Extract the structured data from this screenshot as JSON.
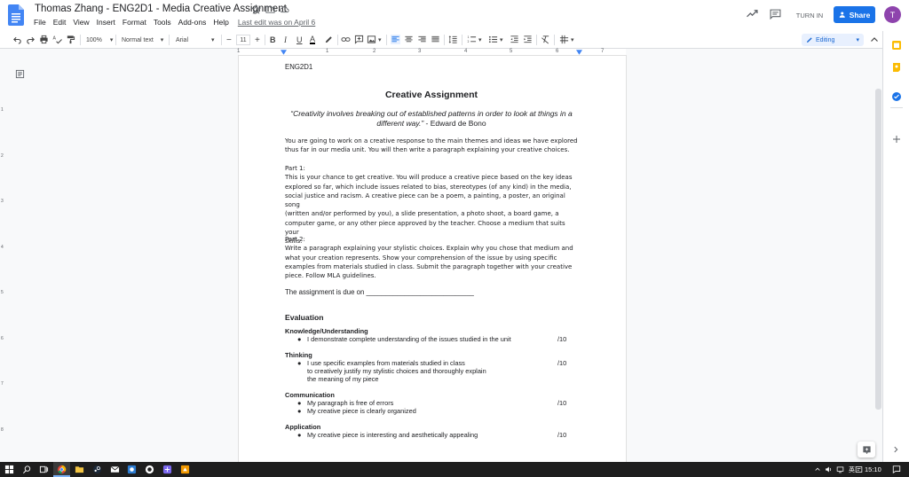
{
  "window": {
    "doc_title": "Thomas Zhang - ENG2D1 - Media Creative Assignment",
    "menu": [
      "File",
      "Edit",
      "View",
      "Insert",
      "Format",
      "Tools",
      "Add-ons",
      "Help"
    ],
    "last_edit": "Last edit was on April 6",
    "turn_in_label": "TURN IN",
    "share_label": "Share",
    "avatar_letter": "T"
  },
  "toolbar": {
    "zoom": "100%",
    "style": "Normal text",
    "font": "Arial",
    "font_size": "11",
    "mode": "Editing"
  },
  "ruler": {
    "numbers": [
      "1",
      "1",
      "2",
      "3",
      "4",
      "5",
      "6",
      "7"
    ],
    "vnumbers": [
      "1",
      "2",
      "3",
      "4",
      "5",
      "6",
      "7",
      "8"
    ]
  },
  "document": {
    "course": "ENG2D1",
    "title": "Creative Assignment",
    "quote_line1": "“Creativity involves breaking out of established patterns in order to look at things in a",
    "quote_line2": "different way.”",
    "quote_author": " - Edward de Bono",
    "intro": [
      "You are going to work on a creative response to the main themes and ideas we have explored",
      "thus far in our media unit. You will then write a paragraph explaining your creative choices."
    ],
    "part1_heading": "Part 1:",
    "part1": [
      "This is your chance to get creative. You will produce a creative piece based on the key ideas",
      "explored so far, which include issues related to bias, stereotypes (of any kind) in the media,",
      "social justice and racism. A creative piece can be a poem, a painting, a poster, an original song",
      "(written and/or performed by you), a slide presentation, a photo shoot, a board game, a",
      "computer game, or any other piece approved by the teacher. Choose a medium that suits your",
      "skills."
    ],
    "part2_heading": "Part 2:",
    "part2": [
      "Write a paragraph explaining your stylistic choices. Explain why you chose that medium and",
      "what your creation represents.  Show your comprehension of the issue by using specific",
      "examples from materials studied in class. Submit the paragraph together with your creative",
      "piece. Follow MLA guidelines."
    ],
    "due": "The assignment is due on ____________________________",
    "evaluation_heading": "Evaluation",
    "criteria": [
      {
        "name": "Knowledge/Understanding",
        "items": [
          {
            "text": "I demonstrate complete understanding of the issues studied in the unit",
            "score": "/10",
            "cont": []
          }
        ]
      },
      {
        "name": "Thinking",
        "items": [
          {
            "text": "I use specific examples from materials studied in class",
            "score": "/10",
            "cont": [
              "to creatively justify my stylistic choices and thoroughly explain",
              "the meaning of my piece"
            ]
          }
        ]
      },
      {
        "name": "Communication",
        "items": [
          {
            "text": "My paragraph is free of errors",
            "score": "/10",
            "cont": []
          },
          {
            "text": "My creative piece is clearly organized",
            "score": "",
            "cont": []
          }
        ]
      },
      {
        "name": "Application",
        "items": [
          {
            "text": "My creative piece is interesting and aesthetically appealing",
            "score": "/10",
            "cont": []
          }
        ]
      }
    ]
  },
  "taskbar": {
    "lang": "英",
    "time": "15:10"
  },
  "colors": {
    "accent": "#1a73e8",
    "avatar": "#8e44ad",
    "docs_blue": "#4285f4"
  }
}
